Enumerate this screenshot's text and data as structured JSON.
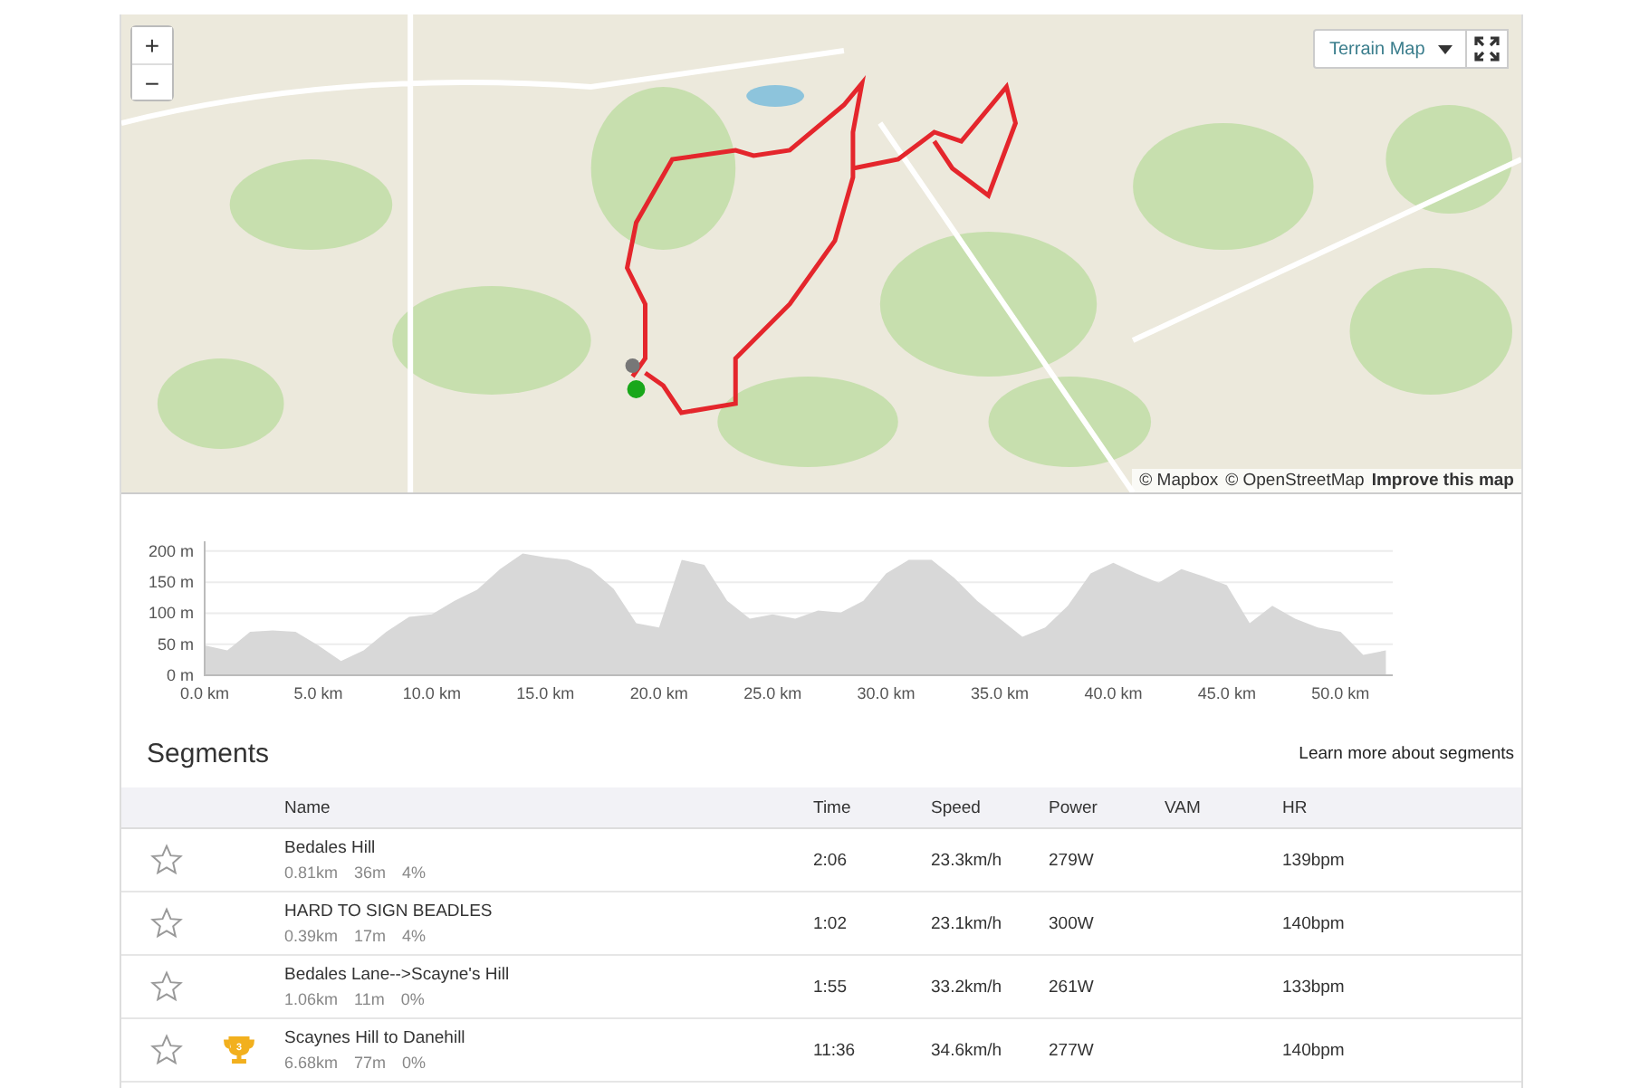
{
  "map": {
    "zoom_in": "+",
    "zoom_out": "−",
    "layer_button": "Terrain Map",
    "attribution": [
      {
        "text": "© Mapbox",
        "bold": false
      },
      {
        "text": "© OpenStreetMap",
        "bold": false
      },
      {
        "text": "Improve this map",
        "bold": true
      }
    ]
  },
  "elevation": {
    "chart_data": {
      "type": "area",
      "x": [
        0,
        1,
        2,
        3,
        4,
        5,
        6,
        7,
        8,
        9,
        10,
        11,
        12,
        13,
        14,
        15,
        16,
        17,
        18,
        19,
        20,
        21,
        22,
        23,
        24,
        25,
        26,
        27,
        28,
        29,
        30,
        31,
        32,
        33,
        34,
        35,
        36,
        37,
        38,
        39,
        40,
        41,
        42,
        43,
        44,
        45,
        46,
        47,
        48,
        49,
        50,
        51,
        52
      ],
      "values": [
        48,
        40,
        70,
        72,
        70,
        48,
        23,
        40,
        70,
        94,
        98,
        120,
        138,
        171,
        196,
        190,
        186,
        171,
        139,
        84,
        77,
        186,
        178,
        120,
        91,
        98,
        91,
        104,
        101,
        120,
        164,
        186,
        186,
        157,
        120,
        91,
        62,
        77,
        112,
        164,
        181,
        164,
        149,
        171,
        159,
        145,
        84,
        112,
        91,
        77,
        70,
        33,
        40
      ],
      "grid": true,
      "xlim": [
        0,
        52.3
      ],
      "ylim": [
        0,
        210
      ],
      "xticks": [
        {
          "value": 0,
          "label": "0.0 km"
        },
        {
          "value": 5,
          "label": "5.0 km"
        },
        {
          "value": 10,
          "label": "10.0 km"
        },
        {
          "value": 15,
          "label": "15.0 km"
        },
        {
          "value": 20,
          "label": "20.0 km"
        },
        {
          "value": 25,
          "label": "25.0 km"
        },
        {
          "value": 30,
          "label": "30.0 km"
        },
        {
          "value": 35,
          "label": "35.0 km"
        },
        {
          "value": 40,
          "label": "40.0 km"
        },
        {
          "value": 45,
          "label": "45.0 km"
        },
        {
          "value": 50,
          "label": "50.0 km"
        }
      ],
      "yticks": [
        {
          "value": 0,
          "label": "0 m"
        },
        {
          "value": 50,
          "label": "50 m"
        },
        {
          "value": 100,
          "label": "100 m"
        },
        {
          "value": 150,
          "label": "150 m"
        },
        {
          "value": 200,
          "label": "200 m"
        }
      ]
    }
  },
  "segments": {
    "title": "Segments",
    "learn_more": "Learn more about segments",
    "columns": [
      "Name",
      "Time",
      "Speed",
      "Power",
      "VAM",
      "HR"
    ],
    "rows": [
      {
        "starred": false,
        "trophy": null,
        "name": "Bedales Hill",
        "stats": [
          "0.81km",
          "36m",
          "4%"
        ],
        "time": "2:06",
        "speed": "23.3km/h",
        "power": "279W",
        "hr": "139bpm"
      },
      {
        "starred": false,
        "trophy": null,
        "name": "HARD TO SIGN BEADLES",
        "stats": [
          "0.39km",
          "17m",
          "4%"
        ],
        "time": "1:02",
        "speed": "23.1km/h",
        "power": "300W",
        "hr": "140bpm"
      },
      {
        "starred": false,
        "trophy": null,
        "name": "Bedales Lane-->Scayne's Hill",
        "stats": [
          "1.06km",
          "11m",
          "0%"
        ],
        "time": "1:55",
        "speed": "33.2km/h",
        "power": "261W",
        "hr": "133bpm"
      },
      {
        "starred": false,
        "trophy": "3",
        "name": "Scaynes Hill to Danehill",
        "stats": [
          "6.68km",
          "77m",
          "0%"
        ],
        "time": "11:36",
        "speed": "34.6km/h",
        "power": "277W",
        "hr": "140bpm"
      }
    ]
  }
}
